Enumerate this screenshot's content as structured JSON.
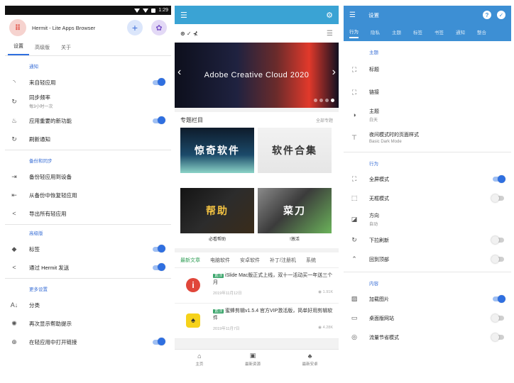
{
  "screen1": {
    "status_time": "1:29",
    "app_title": "Hermit - Lite Apps Browser",
    "logo_glyph": "⠿",
    "tabs": [
      "设置",
      "高级版",
      "关于"
    ],
    "section_notify": "通知",
    "from_lite": "来自轻应用",
    "sync_freq": "同步频率",
    "sync_freq_sub": "每3小时一次",
    "important_new": "应用重要的新功能",
    "refresh_notify": "刷新通知",
    "section_backup": "备份和同步",
    "backup_to_device": "备份轻应用到设备",
    "restore_from_backup": "从备份中恢复轻应用",
    "export_all": "导出所有轻应用",
    "section_premium": "高级版",
    "tags": "标签",
    "send_via_hermit": "通过 Hermit 发送",
    "section_more": "更多设置",
    "sort": "分类",
    "show_tips_again": "再次显示帮助提示",
    "open_links_in_lite": "在轻应用中打开链接"
  },
  "screen2": {
    "logo_text": "⊛ ✓ ⊀",
    "banner_title": "Adobe Creative Cloud 2020",
    "section_title": "专题栏目",
    "section_more": "全部专题",
    "tiles": [
      "惊奇软件",
      "软件合集",
      "帮助",
      "菜刀"
    ],
    "tile_captions": [
      "",
      "",
      "必看帮助",
      "!激活"
    ],
    "tabs": [
      "最新文章",
      "电脑软件",
      "安卓软件",
      "补丁/注册机",
      "系统"
    ],
    "badge": "置顶",
    "article1_title": "iSlide Mac版正式上线，双十一活动买一年送三个月",
    "article1_date": "2019年11月12日",
    "article1_views": "1.91K",
    "article2_title": "蜜蜂剪辑v1.5.4 官方VIP激活版，简单好用剪辑软件",
    "article2_date": "2019年11月7日",
    "article2_views": "4.28K",
    "nav": [
      "主页",
      "最新资源",
      "最新安卓"
    ]
  },
  "screen3": {
    "title": "设置",
    "tabs": [
      "行为",
      "隐私",
      "主题",
      "标签",
      "书签",
      "通知",
      "整合"
    ],
    "section_theme": "主题",
    "title_item": "标题",
    "link_item": "链接",
    "theme": "主题",
    "theme_sub": "白天",
    "night_style": "夜间模式时的页面样式",
    "night_style_sub": "Basic Dark Mode",
    "section_behavior": "行为",
    "fullscreen": "全屏模式",
    "borderless": "无框模式",
    "orientation": "方向",
    "orientation_sub": "自动",
    "pull_refresh": "下拉刷新",
    "back_to_top": "回到顶部",
    "section_content": "内容",
    "load_images": "加载图片",
    "desktop_site": "桌面版网站",
    "data_saver": "流量节省模式"
  }
}
